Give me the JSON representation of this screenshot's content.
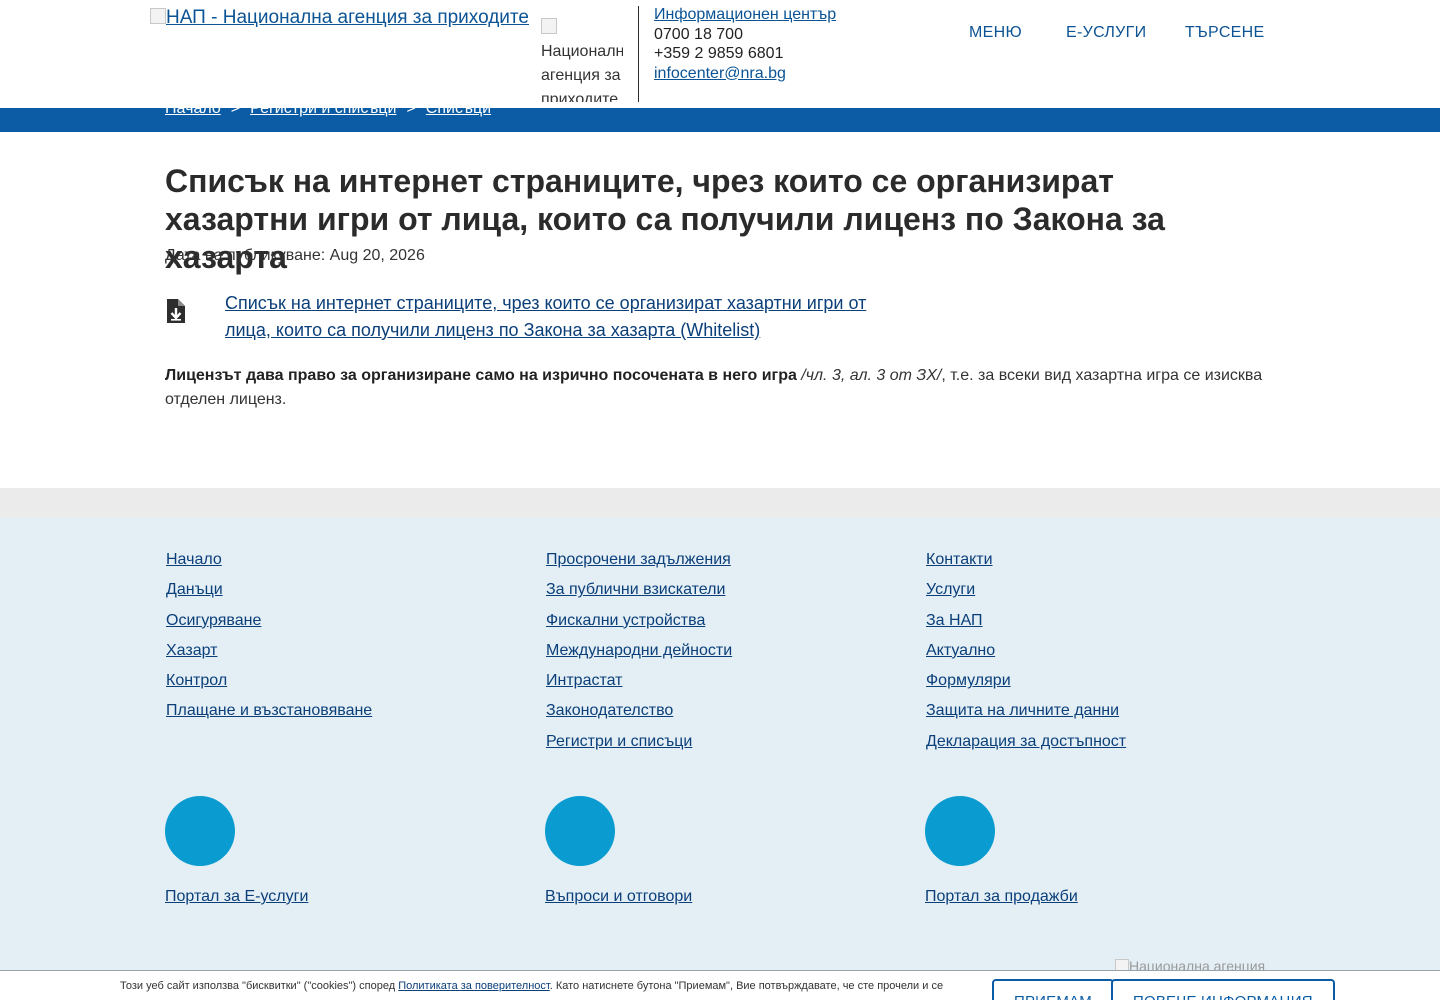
{
  "header": {
    "logo_alt": "НАП - Национална агенция за приходите",
    "logo_small_alt": "Национална агенция за приходите",
    "info_center_label": "Информационен център",
    "phone_1": "0700 18 700",
    "phone_2": "+359 2 9859 6801",
    "email": "infocenter@nra.bg",
    "nav": {
      "menu": "МЕНЮ",
      "eservices": "Е-УСЛУГИ",
      "search": "ТЪРСЕНЕ"
    }
  },
  "breadcrumb": {
    "items": [
      "Начало",
      "Регистри и списъци",
      "Списъци"
    ],
    "separator": ">"
  },
  "main": {
    "title": "Списък на интернет страниците, чрез които се организират хазартни игри от лица, които са получили лиценз по Закона за хазарта",
    "pub_date_label": "Дата на публикуване:",
    "pub_date": "Aug 20, 2026",
    "document_link": "Списък на интернет страниците, чрез които се организират хазартни игри от лица, които са получили лиценз по Закона за хазарта (Whitelist)",
    "document_icon": "file-download-icon",
    "note_bold": "Лицензът дава право за организиране само на изрично посочената в него игра",
    "note_italic": " /чл. 3, ал. 3 от ЗХ/",
    "note_rest": ", т.е. за всеки вид хазартна игра се изисква отделен лиценз."
  },
  "footer": {
    "col1": [
      "Начало",
      "Данъци",
      "Осигуряване",
      "Хазарт",
      "Контрол",
      "Плащане и възстановяване"
    ],
    "col2": [
      "Просрочени задължения",
      "За публични взискатели",
      "Фискални устройства",
      "Международни дейности",
      "Интрастат",
      "Законодателство",
      "Регистри и списъци"
    ],
    "col3": [
      "Контакти",
      "Услуги",
      "За НАП",
      "Актуално",
      "Формуляри",
      "Защита на личните данни",
      "Декларация за достъпност"
    ],
    "portals": [
      "Портал за Е-услуги",
      "Въпроси и отговори",
      "Портал за продажби"
    ],
    "footer_logo_alt": "Национална агенция",
    "circle_color": "#0a9bd0"
  },
  "cookie": {
    "text_before": "Този уеб сайт използва \"бисквитки\" (\"cookies\") според ",
    "policy_link": "Политиката за поверителност",
    "text_after": ". Като натиснете бутона \"Приемам\", Вие потвърждавате, че сте прочели и се",
    "accept": "Приемам",
    "more_info": "Повече информация"
  },
  "colors": {
    "brand_blue": "#0b5ca4",
    "link": "#0b3f7a",
    "footer_bg": "#e4eff5"
  }
}
